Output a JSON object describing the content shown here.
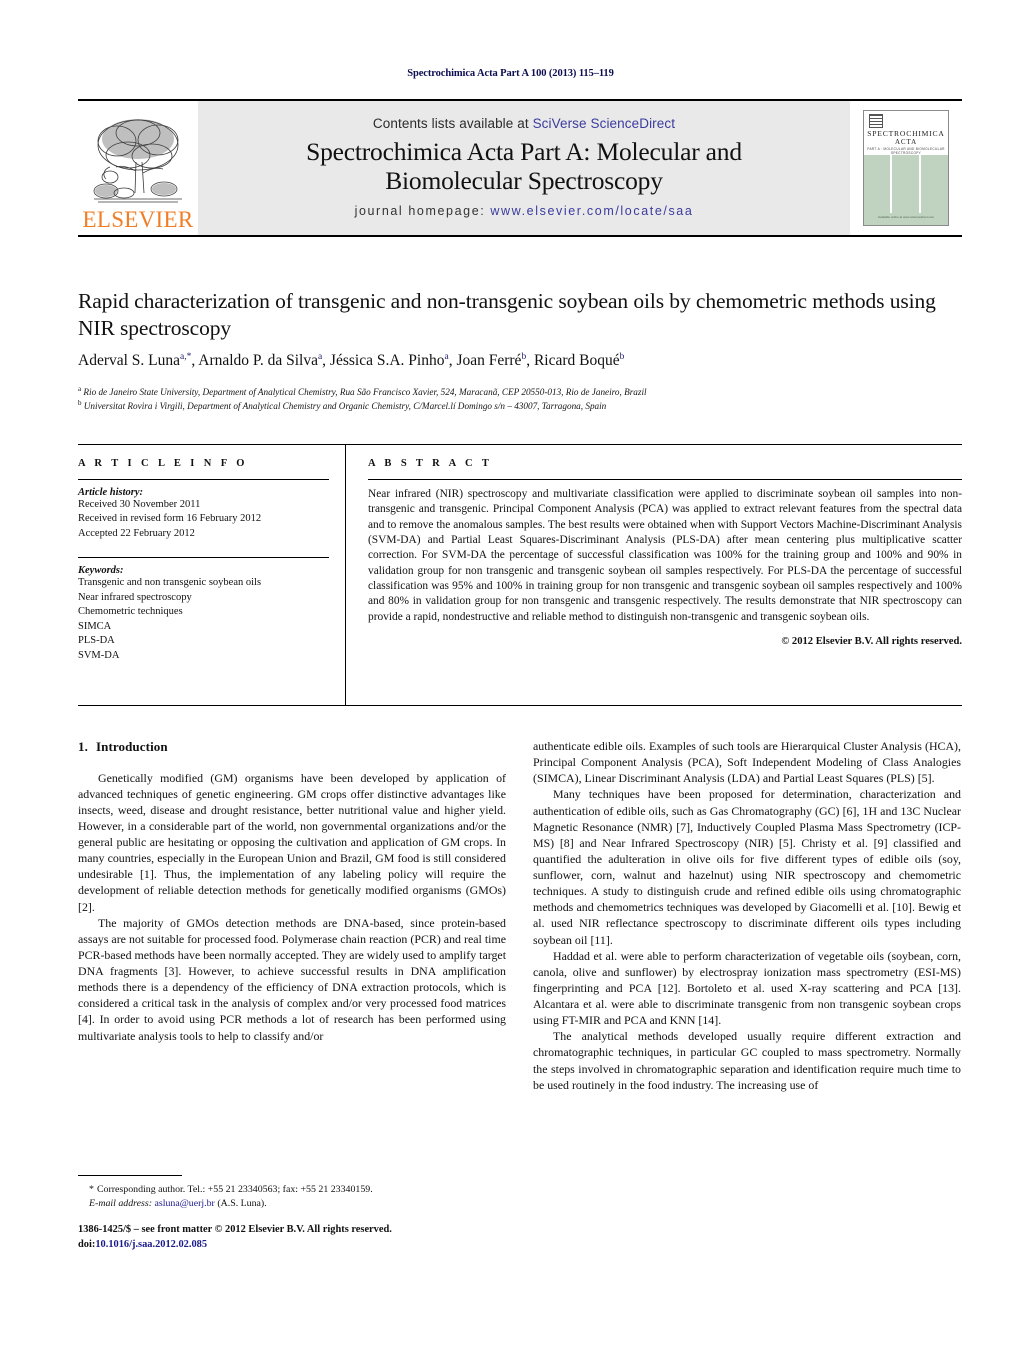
{
  "running_head": "Spectrochimica Acta Part A 100 (2013) 115–119",
  "header": {
    "contents_prefix": "Contents lists available at ",
    "contents_link": "SciVerse ScienceDirect",
    "journal_title_line1": "Spectrochimica Acta Part A: Molecular and",
    "journal_title_line2": "Biomolecular Spectroscopy",
    "homepage_prefix": "journal homepage: ",
    "homepage_url": "www.elsevier.com/locate/saa",
    "publisher_logo_text": "ELSEVIER",
    "cover": {
      "line1": "SPECTROCHIMICA",
      "line2": "ACTA",
      "line3": "PART A : MOLECULAR AND BIOMOLECULAR SPECTROSCOPY",
      "footer": "Available online at www.sciencedirect.com"
    }
  },
  "article": {
    "title": "Rapid characterization of transgenic and non-transgenic soybean oils by chemometric methods using NIR spectroscopy",
    "authors": [
      {
        "name": "Aderval S. Luna",
        "sup": "a,*"
      },
      {
        "name": "Arnaldo P. da Silva",
        "sup": "a"
      },
      {
        "name": "Jéssica S.A. Pinho",
        "sup": "a"
      },
      {
        "name": "Joan Ferré",
        "sup": "b"
      },
      {
        "name": "Ricard Boqué",
        "sup": "b"
      }
    ],
    "affiliations": [
      {
        "sup": "a",
        "text": "Rio de Janeiro State University, Department of Analytical Chemistry, Rua São Francisco Xavier, 524, Maracanã, CEP 20550-013, Rio de Janeiro, Brazil"
      },
      {
        "sup": "b",
        "text": "Universitat Rovira i Virgili, Department of Analytical Chemistry and Organic Chemistry, C/Marcel.lí Domingo s/n – 43007, Tarragona, Spain"
      }
    ]
  },
  "article_info": {
    "heading": "A R T I C L E    I N F O",
    "history_label": "Article history:",
    "history": [
      "Received 30 November 2011",
      "Received in revised form 16 February 2012",
      "Accepted 22 February 2012"
    ],
    "keywords_label": "Keywords:",
    "keywords": [
      "Transgenic and non transgenic soybean oils",
      "Near infrared spectroscopy",
      "Chemometric techniques",
      "SIMCA",
      "PLS-DA",
      "SVM-DA"
    ]
  },
  "abstract": {
    "heading": "A B S T R A C T",
    "text": "Near infrared (NIR) spectroscopy and multivariate classification were applied to discriminate soybean oil samples into non-transgenic and transgenic. Principal Component Analysis (PCA) was applied to extract relevant features from the spectral data and to remove the anomalous samples. The best results were obtained when with Support Vectors Machine-Discriminant Analysis (SVM-DA) and Partial Least Squares-Discriminant Analysis (PLS-DA) after mean centering plus multiplicative scatter correction. For SVM-DA the percentage of successful classification was 100% for the training group and 100% and 90% in validation group for non transgenic and transgenic soybean oil samples respectively. For PLS-DA the percentage of successful classification was 95% and 100% in training group for non transgenic and transgenic soybean oil samples respectively and 100% and 80% in validation group for non transgenic and transgenic respectively. The results demonstrate that NIR spectroscopy can provide a rapid, nondestructive and reliable method to distinguish non-transgenic and transgenic soybean oils.",
    "copyright": "© 2012 Elsevier B.V. All rights reserved."
  },
  "body": {
    "section_number": "1.",
    "section_title": "Introduction",
    "left_paragraphs": [
      "Genetically modified (GM) organisms have been developed by application of advanced techniques of genetic engineering. GM crops offer distinctive advantages like insects, weed, disease and drought resistance, better nutritional value and higher yield. However, in a considerable part of the world, non governmental organizations and/or the general public are hesitating or opposing the cultivation and application of GM crops. In many countries, especially in the European Union and Brazil, GM food is still considered undesirable [1]. Thus, the implementation of any labeling policy will require the development of reliable detection methods for genetically modified organisms (GMOs) [2].",
      "The majority of GMOs detection methods are DNA-based, since protein-based assays are not suitable for processed food. Polymerase chain reaction (PCR) and real time PCR-based methods have been normally accepted. They are widely used to amplify target DNA fragments [3]. However, to achieve successful results in DNA amplification methods there is a dependency of the efficiency of DNA extraction protocols, which is considered a critical task in the analysis of complex and/or very processed food matrices [4]. In order to avoid using PCR methods a lot of research has been performed using multivariate analysis tools to help to classify and/or"
    ],
    "right_paragraphs": [
      "authenticate edible oils. Examples of such tools are Hierarquical Cluster Analysis (HCA), Principal Component Analysis (PCA), Soft Independent Modeling of Class Analogies (SIMCA), Linear Discriminant Analysis (LDA) and Partial Least Squares (PLS) [5].",
      "Many techniques have been proposed for determination, characterization and authentication of edible oils, such as Gas Chromatography (GC) [6], 1H and 13C Nuclear Magnetic Resonance (NMR) [7], Inductively Coupled Plasma Mass Spectrometry (ICP-MS) [8] and Near Infrared Spectroscopy (NIR) [5]. Christy et al. [9] classified and quantified the adulteration in olive oils for five different types of edible oils (soy, sunflower, corn, walnut and hazelnut) using NIR spectroscopy and chemometric techniques. A study to distinguish crude and refined edible oils using chromatographic methods and chemometrics techniques was developed by Giacomelli et al. [10]. Bewig et al. used NIR reflectance spectroscopy to discriminate different oils types including soybean oil [11].",
      "Haddad et al. were able to perform characterization of vegetable oils (soybean, corn, canola, olive and sunflower) by electrospray ionization mass spectrometry (ESI-MS) fingerprinting and PCA [12]. Bortoleto et al. used X-ray scattering and PCA [13]. Alcantara et al. were able to discriminate transgenic from non transgenic soybean crops using FT-MIR and PCA and KNN [14].",
      "The analytical methods developed usually require different extraction and chromatographic techniques, in particular GC coupled to mass spectrometry. Normally the steps involved in chromatographic separation and identification require much time to be used routinely in the food industry. The increasing use of"
    ]
  },
  "footnote": {
    "star": "*",
    "line1": "Corresponding author. Tel.: +55 21 23340563; fax: +55 21 23340159.",
    "email_label": "E-mail address:",
    "email": "asluna@uerj.br",
    "email_suffix": "(A.S. Luna)."
  },
  "bottom_matter": {
    "issn_line": "1386-1425/$ – see front matter © 2012 Elsevier B.V. All rights reserved.",
    "doi_prefix": "doi:",
    "doi": "10.1016/j.saa.2012.02.085"
  }
}
